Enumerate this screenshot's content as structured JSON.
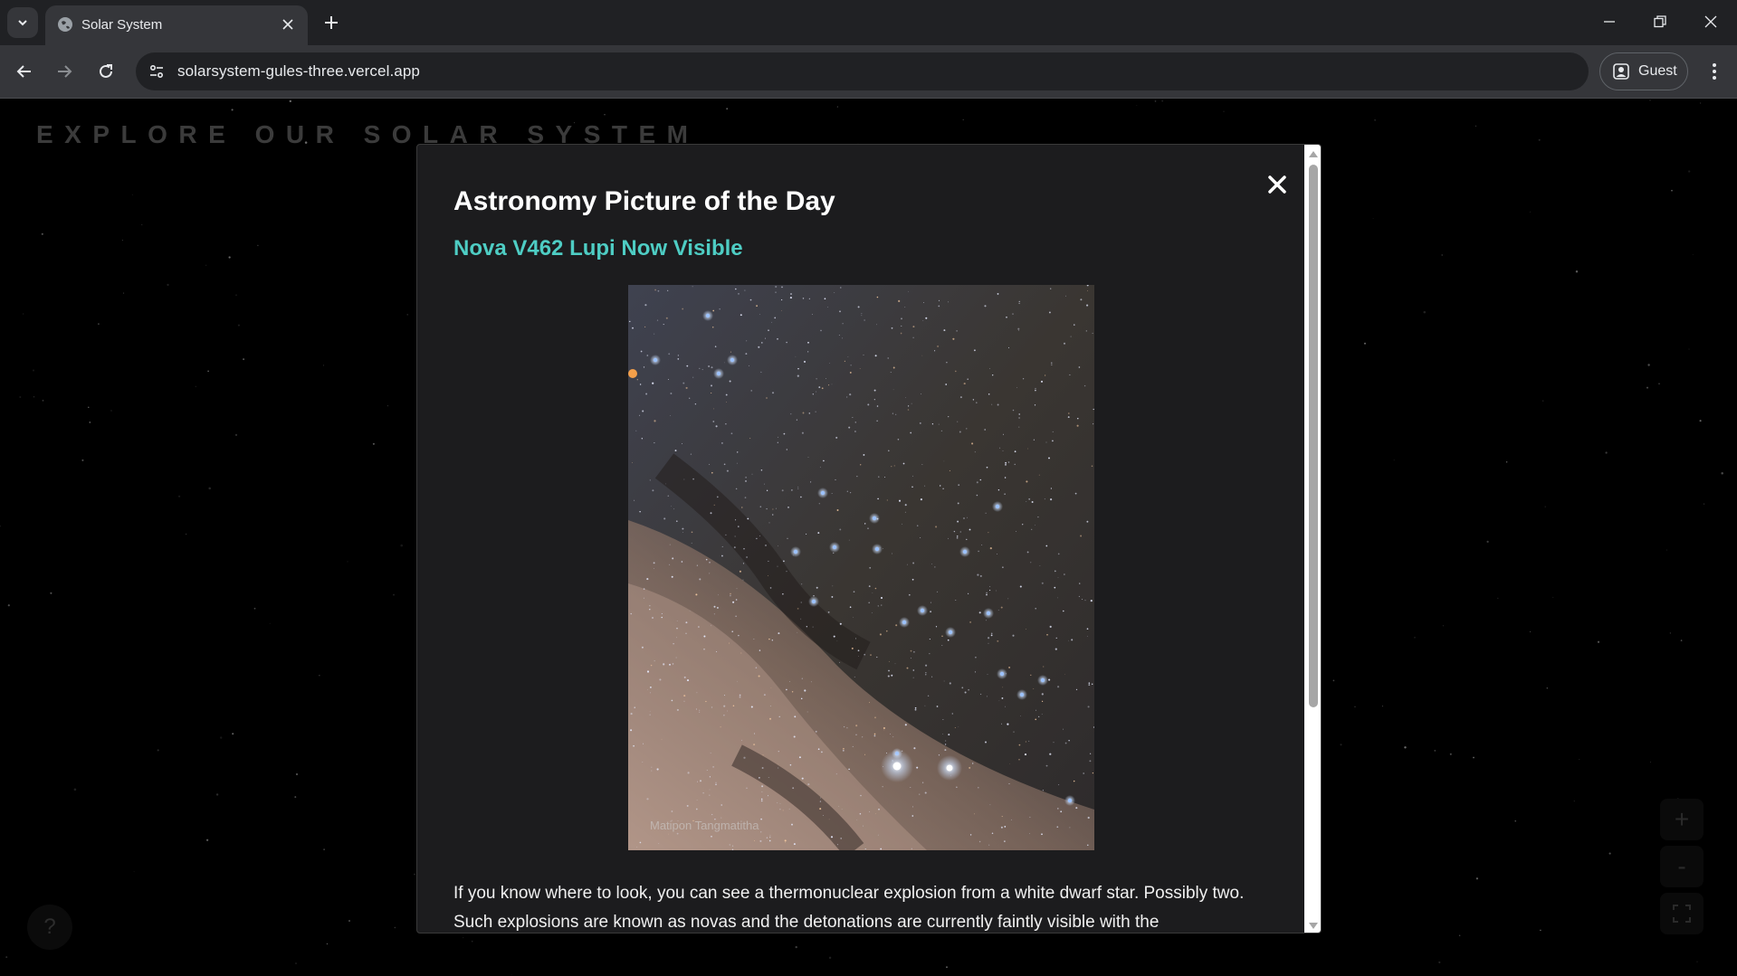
{
  "browser": {
    "tab_title": "Solar System",
    "url": "solarsystem-gules-three.vercel.app",
    "profile_label": "Guest"
  },
  "page": {
    "heading": "EXPLORE OUR SOLAR SYSTEM",
    "help_label": "?",
    "zoom_in_label": "+",
    "zoom_out_label": "-"
  },
  "modal": {
    "title": "Astronomy Picture of the Day",
    "apod_title": "Nova V462 Lupi Now Visible",
    "image_credit": "Matipon Tangmatitha",
    "explanation": "If you know where to look, you can see a thermonuclear explosion from a white dwarf star. Possibly two. Such explosions are known as novas and the detonations are currently faintly visible with the"
  },
  "colors": {
    "accent": "#4ecdc4",
    "modal_bg": "#1c1c1e",
    "page_bg": "#000000"
  }
}
